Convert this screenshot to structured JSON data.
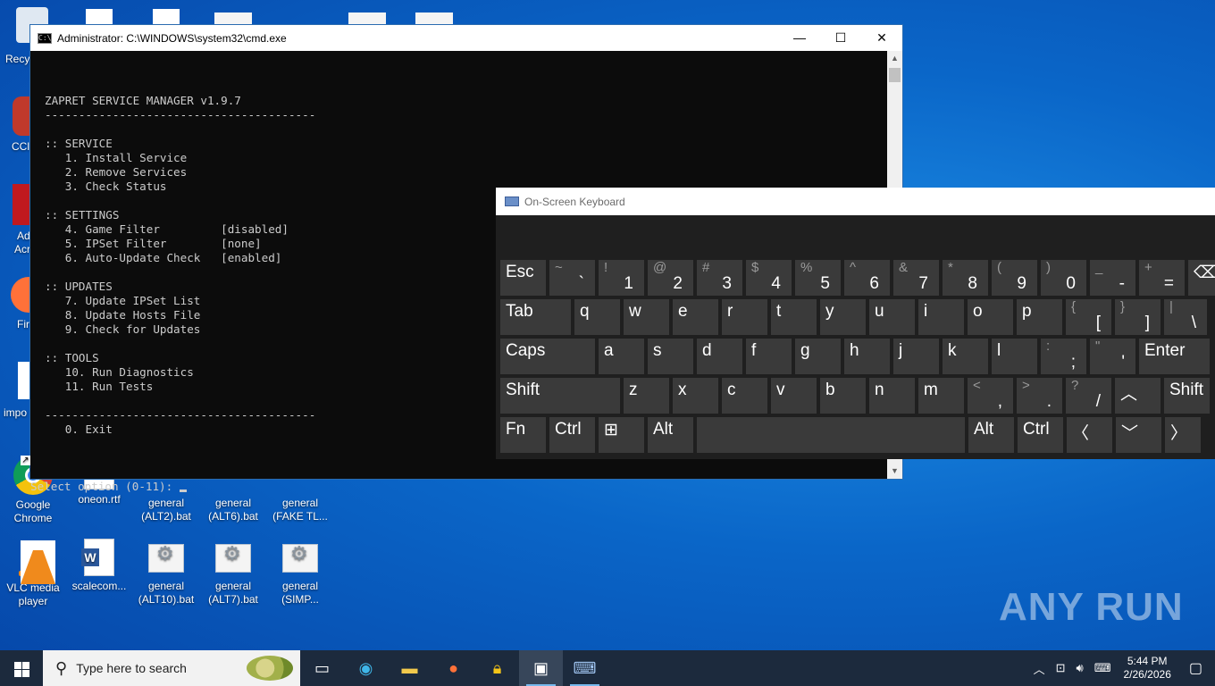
{
  "desktop": {
    "partial_labels": {
      "recycle": "Recy",
      "ccleaner": "CCl",
      "adobe1": "Ad",
      "adobe2": "Acr",
      "firefox": "Fir",
      "import": "impo"
    },
    "icons": [
      {
        "label": "Google Chrome"
      },
      {
        "label": "oneon.rtf"
      },
      {
        "label": "general (ALT2).bat"
      },
      {
        "label": "general (ALT6).bat"
      },
      {
        "label": "general (FAKE TL..."
      },
      {
        "label": "VLC media player"
      },
      {
        "label": "scalecom..."
      },
      {
        "label": "general (ALT10).bat"
      },
      {
        "label": "general (ALT7).bat"
      },
      {
        "label": "general (SIMP..."
      }
    ]
  },
  "cmd": {
    "title": "Administrator: C:\\WINDOWS\\system32\\cmd.exe",
    "icon_text": "C:\\",
    "buttons": {
      "minimize": "—",
      "maximize": "☐",
      "close": "✕"
    },
    "lines": [
      "ZAPRET SERVICE MANAGER v1.9.7",
      "----------------------------------------",
      "",
      ":: SERVICE",
      "   1. Install Service",
      "   2. Remove Services",
      "   3. Check Status",
      "",
      ":: SETTINGS",
      "   4. Game Filter         [disabled]",
      "   5. IPSet Filter        [none]",
      "   6. Auto-Update Check   [enabled]",
      "",
      ":: UPDATES",
      "   7. Update IPSet List",
      "   8. Update Hosts File",
      "   9. Check for Updates",
      "",
      ":: TOOLS",
      "   10. Run Diagnostics",
      "   11. Run Tests",
      "",
      "----------------------------------------",
      "   0. Exit",
      ""
    ],
    "prompt": "Select option (0-11):"
  },
  "osk": {
    "title": "On-Screen Keyboard",
    "rows": [
      [
        {
          "main": "Esc",
          "w": 51
        },
        {
          "sec": "~",
          "main": "`",
          "w": 51
        },
        {
          "sec": "!",
          "main": "1",
          "w": 51
        },
        {
          "sec": "@",
          "main": "2",
          "w": 51
        },
        {
          "sec": "#",
          "main": "3",
          "w": 51
        },
        {
          "sec": "$",
          "main": "4",
          "w": 51
        },
        {
          "sec": "%",
          "main": "5",
          "w": 51
        },
        {
          "sec": "^",
          "main": "6",
          "w": 51
        },
        {
          "sec": "&",
          "main": "7",
          "w": 51
        },
        {
          "sec": "*",
          "main": "8",
          "w": 51
        },
        {
          "sec": "(",
          "main": "9",
          "w": 51
        },
        {
          "sec": ")",
          "main": "0",
          "w": 51
        },
        {
          "sec": "_",
          "main": "-",
          "w": 51
        },
        {
          "sec": "+",
          "main": "=",
          "w": 51
        },
        {
          "main": "⌫",
          "w": 40
        }
      ],
      [
        {
          "main": "Tab",
          "w": 79
        },
        {
          "main": "q",
          "w": 51
        },
        {
          "main": "w",
          "w": 51
        },
        {
          "main": "e",
          "w": 51
        },
        {
          "main": "r",
          "w": 51
        },
        {
          "main": "t",
          "w": 51
        },
        {
          "main": "y",
          "w": 51
        },
        {
          "main": "u",
          "w": 51
        },
        {
          "main": "i",
          "w": 51
        },
        {
          "main": "o",
          "w": 51
        },
        {
          "main": "p",
          "w": 51
        },
        {
          "sec": "{",
          "main": "[",
          "w": 51
        },
        {
          "sec": "}",
          "main": "]",
          "w": 51
        },
        {
          "sec": "|",
          "main": "\\",
          "w": 48
        }
      ],
      [
        {
          "main": "Caps",
          "w": 106
        },
        {
          "main": "a",
          "w": 51
        },
        {
          "main": "s",
          "w": 51
        },
        {
          "main": "d",
          "w": 51
        },
        {
          "main": "f",
          "w": 51
        },
        {
          "main": "g",
          "w": 51
        },
        {
          "main": "h",
          "w": 51
        },
        {
          "main": "j",
          "w": 51
        },
        {
          "main": "k",
          "w": 51
        },
        {
          "main": "l",
          "w": 51
        },
        {
          "sec": ":",
          "main": ";",
          "w": 51
        },
        {
          "sec": "\"",
          "main": "'",
          "w": 51
        },
        {
          "main": "Enter",
          "w": 79
        }
      ],
      [
        {
          "main": "Shift",
          "w": 134
        },
        {
          "main": "z",
          "w": 51
        },
        {
          "main": "x",
          "w": 51
        },
        {
          "main": "c",
          "w": 51
        },
        {
          "main": "v",
          "w": 51
        },
        {
          "main": "b",
          "w": 51
        },
        {
          "main": "n",
          "w": 51
        },
        {
          "main": "m",
          "w": 51
        },
        {
          "sec": "<",
          "main": ",",
          "w": 51
        },
        {
          "sec": ">",
          "main": ".",
          "w": 51
        },
        {
          "sec": "?",
          "main": "/",
          "w": 51
        },
        {
          "main": "︿",
          "w": 51
        },
        {
          "main": "Shift",
          "w": 51
        }
      ],
      [
        {
          "main": "Fn",
          "w": 51
        },
        {
          "main": "Ctrl",
          "w": 51
        },
        {
          "main": "⊞",
          "w": 51
        },
        {
          "main": "Alt",
          "w": 51
        },
        {
          "main": "",
          "w": 300
        },
        {
          "main": "Alt",
          "w": 51
        },
        {
          "main": "Ctrl",
          "w": 51
        },
        {
          "main": "〈",
          "w": 51
        },
        {
          "main": "﹀",
          "w": 51
        },
        {
          "main": "〉",
          "w": 40
        }
      ]
    ]
  },
  "watermark": "ANY RUN",
  "taskbar": {
    "search_placeholder": "Type here to search",
    "clock_time": "5:44 PM",
    "clock_date": "2/26/2026"
  }
}
